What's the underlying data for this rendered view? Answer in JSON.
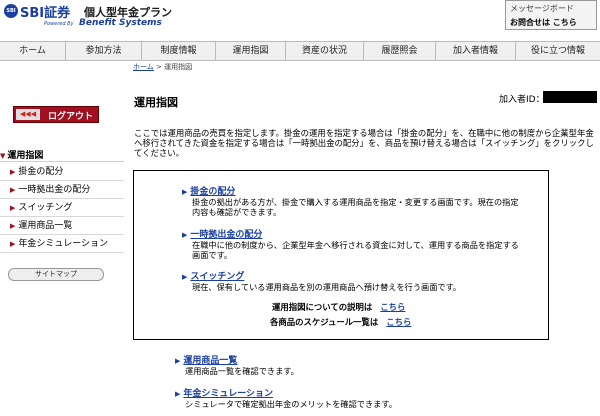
{
  "header": {
    "logo_mark": "SBI",
    "logo_main": "SBI証券",
    "logo_plan": "個人型年金プラン",
    "powered_by": "Powered By",
    "benefit_systems": "Benefit Systems",
    "message_board": "メッセージボード",
    "contact": "お問合せは こちら"
  },
  "nav": {
    "items": [
      "ホーム",
      "参加方法",
      "制度情報",
      "運用指図",
      "資産の状況",
      "履歴照会",
      "加入者情報",
      "役に立つ情報"
    ]
  },
  "breadcrumb": {
    "home": "ホーム",
    "separator": " > ",
    "current": "運用指図"
  },
  "sidebar": {
    "logout_arrows": "◀◀◀",
    "logout_label": "ログアウト",
    "section_title": "運用指図",
    "items": [
      "掛金の配分",
      "一時拠出金の配分",
      "スイッチング",
      "運用商品一覧",
      "年金シミュレーション"
    ],
    "sitemap_label": "サイトマップ"
  },
  "main": {
    "page_title": "運用指図",
    "member_id_label": "加入者ID：",
    "intro": "ここでは運用商品の売買を指定します。掛金の運用を指定する場合は「掛金の配分」を、在職中に他の制度から企業型年金へ移行されてきた資金を指定する場合は「一時拠出金の配分」を、商品を預け替える場合は「スイッチング」をクリックしてください。",
    "options": [
      {
        "title": "掛金の配分",
        "desc": "掛金の拠出がある方が、掛金で購入する運用商品を指定・変更する画面です。現在の指定内容も確認ができます。"
      },
      {
        "title": "一時拠出金の配分",
        "desc": "在職中に他の制度から、企業型年金へ移行される資金に対して、運用する商品を指定する画面です。"
      },
      {
        "title": "スイッチング",
        "desc": "現在、保有している運用商品を別の運用商品へ預け替えを行う画面です。"
      }
    ],
    "ref1_label": "運用指図についての説明は",
    "ref1_link": "こちら",
    "ref2_label": "各商品のスケジュール一覧は",
    "ref2_link": "こちら",
    "below": [
      {
        "title": "運用商品一覧",
        "desc": "運用商品一覧を確認できます。"
      },
      {
        "title": "年金シミュレーション",
        "desc": "シミュレータで確定拠出年金のメリットを確認できます。"
      }
    ]
  }
}
